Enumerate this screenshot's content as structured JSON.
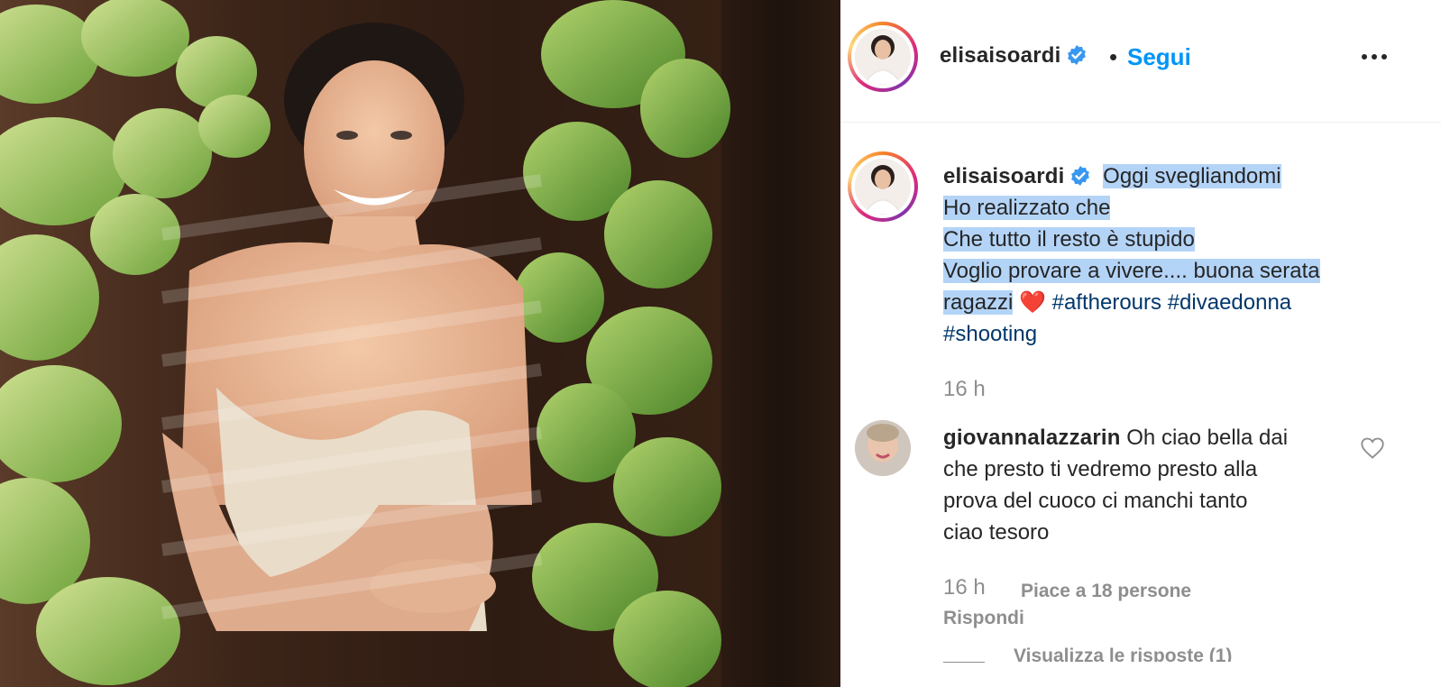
{
  "post": {
    "username": "elisaisoardi",
    "follow_label": "Segui",
    "dot": "•"
  },
  "caption": {
    "username": "elisaisoardi",
    "line1": "Oggi svegliandomi",
    "line2": "Ho realizzato che",
    "line3": "Che tutto il resto è stupido",
    "line4": "Voglio provare a vivere.... buona serata",
    "line5a": "ragazzi",
    "heart": "❤️",
    "hashtags": [
      "#aftherours",
      "#divaedonna",
      "#shooting"
    ],
    "time": "16 h"
  },
  "comment": {
    "username": "giovannalazzarin",
    "text1": "Oh ciao bella dai",
    "text2": "che presto ti vedremo presto alla",
    "text3": "prova del cuoco ci manchi tanto",
    "text4": "ciao tesoro",
    "time": "16 h",
    "likes": "Piace a 18 persone",
    "reply": "Rispondi",
    "view_replies": "Visualizza le risposte (1)"
  },
  "colors": {
    "accent": "#0095f6",
    "verified": "#3897f0",
    "hashtag": "#00376b",
    "muted": "#8e8e8e",
    "selection": "#b4d4f7"
  }
}
